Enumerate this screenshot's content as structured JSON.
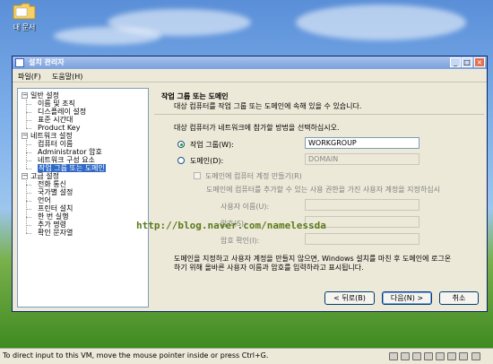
{
  "desktop": {
    "icon_label": "내 문서"
  },
  "window": {
    "title": "설치 관리자",
    "menu": [
      "파일(F)",
      "도움말(H)"
    ],
    "controls": {
      "minimize": "_",
      "maximize": "□",
      "close": "×"
    }
  },
  "tree": {
    "groups": [
      {
        "label": "일반 설정",
        "items": [
          "이름 및 조직",
          "디스플레이 설정",
          "표준 시간대",
          "Product Key"
        ]
      },
      {
        "label": "네트워크 설정",
        "items": [
          "컴퓨터 이름",
          "Administrator 암호",
          "네트워크 구성 요소",
          "작업 그룹 또는 도메인"
        ]
      },
      {
        "label": "고급 설정",
        "items": [
          "전화 통신",
          "국가별 설정",
          "언어",
          "프린터 설치",
          "한 번 실행",
          "추가 명령",
          "확인 문자열"
        ]
      }
    ],
    "selected": "작업 그룹 또는 도메인"
  },
  "pane": {
    "title": "작업 그룹 또는 도메인",
    "subtitle": "대상 컴퓨터를 작업 그룹 또는 도메인에 속해 있을 수 있습니다.",
    "question": "대상 컴퓨터가 네트워크에 참가할 방법을 선택하십시오.",
    "workgroup_label": "작업 그룹(W):",
    "workgroup_value": "WORKGROUP",
    "domain_label": "도메인(D):",
    "domain_value": "DOMAIN",
    "create_account_label": "도메인에 컴퓨터 계정 만들기(R)",
    "create_account_desc": "도메인에 컴퓨터를 추가할 수 있는 사용 권한을 가진 사용자 계정을 지정하십시",
    "username_label": "사용자 이름(U):",
    "password_label": "암호(S):",
    "confirm_label": "암호 확인(I):",
    "note_line1": "도메인을 지정하고 사용자 계정을 만들지 않으면, Windows 설치를 마친 후 도메인에 로그온",
    "note_line2": "하기 위해 올바른 사용자 이름과 암호를 입력하라고 표시됩니다."
  },
  "buttons": {
    "back": "< 뒤로(B)",
    "next": "다음(N) >",
    "cancel": "취소"
  },
  "watermark": "http://blog.naver.com/namelessda",
  "statusbar": {
    "message": "To direct input to this VM, move the mouse pointer inside or press Ctrl+G."
  }
}
